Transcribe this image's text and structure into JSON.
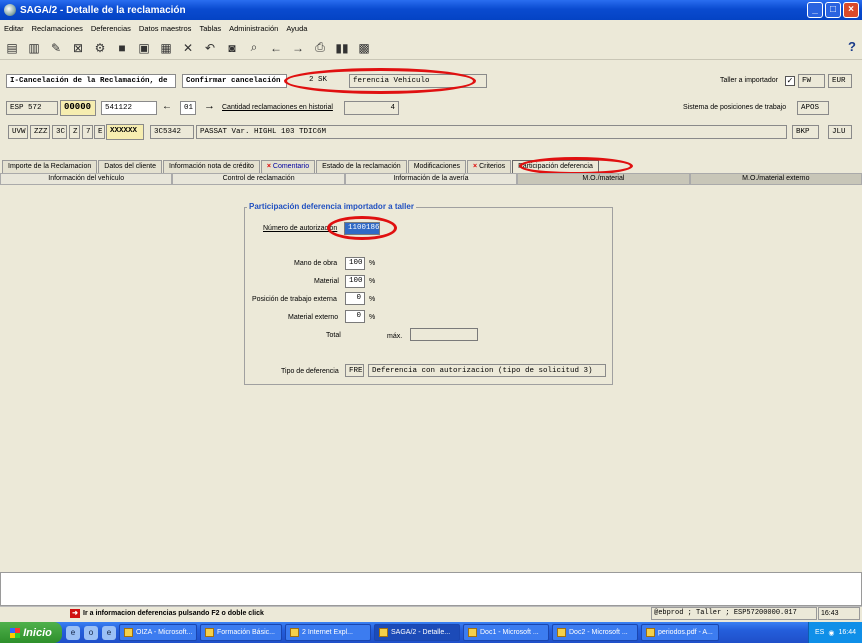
{
  "window": {
    "title": "SAGA/2 - Detalle de la reclamación"
  },
  "menu": [
    "Editar",
    "Reclamaciones",
    "Deferencias",
    "Datos maestros",
    "Tablas",
    "Administración",
    "Ayuda"
  ],
  "toolbar": {
    "icons": [
      "new-icon",
      "copy-icon",
      "edit-icon",
      "delete-icon",
      "tools-icon",
      "save-icon",
      "clipboard-icon",
      "paste-icon",
      "cancel-icon",
      "undo-icon",
      "binoculars-icon",
      "search-icon",
      "back-arrow-icon",
      "forward-arrow-icon",
      "print-icon",
      "barcode-icon",
      "calculator-icon"
    ],
    "help": "?"
  },
  "header": {
    "row1": {
      "status": "I-Cancelación de la Reclamación, de",
      "action": "Confirmar cancelación",
      "code": "2 SK",
      "description": "ferencia Vehículo",
      "taller_label": "Taller a importador",
      "taller_checked": "✓",
      "brand": "FW",
      "currency": "EUR"
    },
    "row2": {
      "country": "ESP 572",
      "number": "00000",
      "claim": "541122",
      "sequence": "01",
      "history_label": "Cantidad reclamaciones en historial",
      "history_count": "4",
      "system_label": "Sistema de posiciones de trabajo",
      "system_value": "APOS"
    },
    "row3": {
      "codes": [
        "UVW",
        "ZZZ",
        "3C",
        "Z",
        "7",
        "E"
      ],
      "vin": "XXXXXX",
      "model_code": "3C5342",
      "model_name": "PASSAT Var. HIGHL 103 TDIC6M",
      "code1": "BKP",
      "code2": "JLU"
    }
  },
  "tabs": {
    "row1": [
      {
        "label": "Importe de la Reclamacion",
        "marked": ""
      },
      {
        "label": "Datos del cliente",
        "marked": ""
      },
      {
        "label": "Información nota de crédito",
        "marked": ""
      },
      {
        "label": "Comentario",
        "marked": "×"
      },
      {
        "label": "Estado de la reclamación",
        "marked": ""
      },
      {
        "label": "Modificaciones",
        "marked": ""
      },
      {
        "label": "Criterios",
        "marked": "×"
      },
      {
        "label": "Participación deferencia",
        "marked": ""
      }
    ],
    "row2": [
      "Información del vehículo",
      "Control de reclamación",
      "Información de la avería",
      "M.O./material",
      "M.O./material externo"
    ]
  },
  "panel": {
    "title": "Participación deferencia importador a taller",
    "auth_label": "Número de autorización",
    "auth_value": "1100186",
    "rows": [
      {
        "label": "Mano de obra",
        "value": "100",
        "unit": "%"
      },
      {
        "label": "Material",
        "value": "100",
        "unit": "%"
      },
      {
        "label": "Posición de trabajo externa",
        "value": "0",
        "unit": "%"
      },
      {
        "label": "Material externo",
        "value": "0",
        "unit": "%"
      }
    ],
    "total_label": "Total",
    "max_label": "máx.",
    "type_label": "Tipo de deferencia",
    "type_code": "FRE",
    "type_desc": "Deferencia con autorizacion (tipo de solicitud 3)"
  },
  "status": {
    "message": "Ir a informacion deferencias pulsando F2 o doble click",
    "info": "@ebprod ; Taller ; ESP57200000.017",
    "time": "16:43"
  },
  "taskbar": {
    "start": "Inicio",
    "tasks": [
      "OIZA - Microsoft...",
      "Formación Básic...",
      "2 Internet Expl...",
      "SAGA/2 - Detalle...",
      "Doc1 - Microsoft ...",
      "Doc2 - Microsoft ...",
      "periodos.pdf - A..."
    ],
    "lang": "ES",
    "clock": "16:44"
  },
  "highlight_color": "#e01010"
}
